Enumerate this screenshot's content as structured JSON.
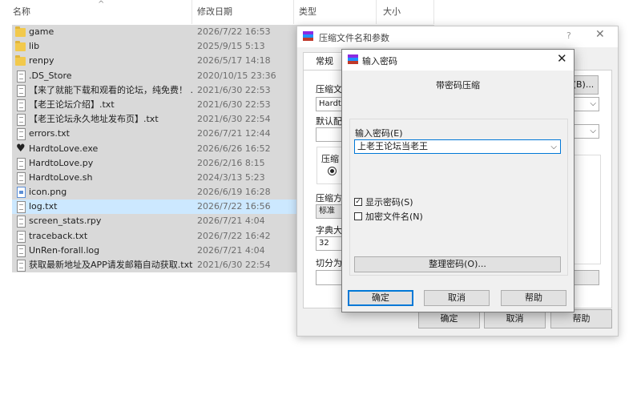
{
  "explorer": {
    "columns": {
      "name": "名称",
      "date": "修改日期",
      "type": "类型",
      "size": "大小"
    },
    "sort_indicator": "^",
    "files": [
      {
        "icon": "folder-icon",
        "name": "game",
        "date": "2026/7/22 16:53"
      },
      {
        "icon": "folder-icon",
        "name": "lib",
        "date": "2025/9/15 5:13"
      },
      {
        "icon": "folder-icon",
        "name": "renpy",
        "date": "2026/5/17 14:18"
      },
      {
        "icon": "file-icon",
        "name": ".DS_Store",
        "date": "2020/10/15 23:36"
      },
      {
        "icon": "text-file-icon",
        "name": "【来了就能下载和观看的论坛，纯免费！ ...",
        "date": "2021/6/30 22:53"
      },
      {
        "icon": "text-file-icon",
        "name": "【老王论坛介绍】.txt",
        "date": "2021/6/30 22:53"
      },
      {
        "icon": "text-file-icon",
        "name": "【老王论坛永久地址发布页】.txt",
        "date": "2021/6/30 22:54"
      },
      {
        "icon": "text-file-icon",
        "name": "errors.txt",
        "date": "2026/7/21 12:44"
      },
      {
        "icon": "exe-icon",
        "name": "HardtoLove.exe",
        "date": "2026/6/26 16:52"
      },
      {
        "icon": "file-icon",
        "name": "HardtoLove.py",
        "date": "2026/2/16 8:15"
      },
      {
        "icon": "file-icon",
        "name": "HardtoLove.sh",
        "date": "2024/3/13 5:23"
      },
      {
        "icon": "image-file-icon",
        "name": "icon.png",
        "date": "2026/6/19 16:28"
      },
      {
        "icon": "text-file-icon",
        "name": "log.txt",
        "date": "2026/7/22 16:56",
        "selected": true
      },
      {
        "icon": "file-icon",
        "name": "screen_stats.rpy",
        "date": "2026/7/21 4:04"
      },
      {
        "icon": "text-file-icon",
        "name": "traceback.txt",
        "date": "2026/7/22 16:42"
      },
      {
        "icon": "file-icon",
        "name": "UnRen-forall.log",
        "date": "2026/7/21 4:04"
      },
      {
        "icon": "text-file-icon",
        "name": "获取最新地址及APP请发邮箱自动获取.txt",
        "date": "2021/6/30 22:54"
      }
    ]
  },
  "archive_dialog": {
    "title": "压缩文件名和参数",
    "help_glyph": "?",
    "close_glyph": "✕",
    "tab_general": "常规",
    "archive_name_label": "压缩文",
    "archive_name_value": "Hardto",
    "browse_button": "(B)...",
    "default_profile_label": "默认配",
    "archive_format_label": "压缩",
    "compression_method_label": "压缩方",
    "compression_method_value": "标准",
    "dictionary_size_label": "字典大",
    "dictionary_size_value": "32",
    "split_label": "切分为",
    "ok_button": "确定",
    "cancel_button": "取消",
    "help_button": "帮助"
  },
  "password_dialog": {
    "title": "输入密码",
    "close_glyph": "✕",
    "subtitle": "带密码压缩",
    "password_label": "输入密码(E)",
    "password_value": "上老王论坛当老王",
    "show_password_label": "显示密码(S)",
    "show_password_checked": true,
    "encrypt_filenames_label": "加密文件名(N)",
    "encrypt_filenames_checked": false,
    "organize_button": "整理密码(O)...",
    "ok_button": "确定",
    "cancel_button": "取消",
    "help_button": "帮助"
  },
  "colors": {
    "row_background": "#d9d9d9",
    "selected_row": "#cce8ff",
    "focus_accent": "#0078d7",
    "folder": "#f2c94c"
  }
}
